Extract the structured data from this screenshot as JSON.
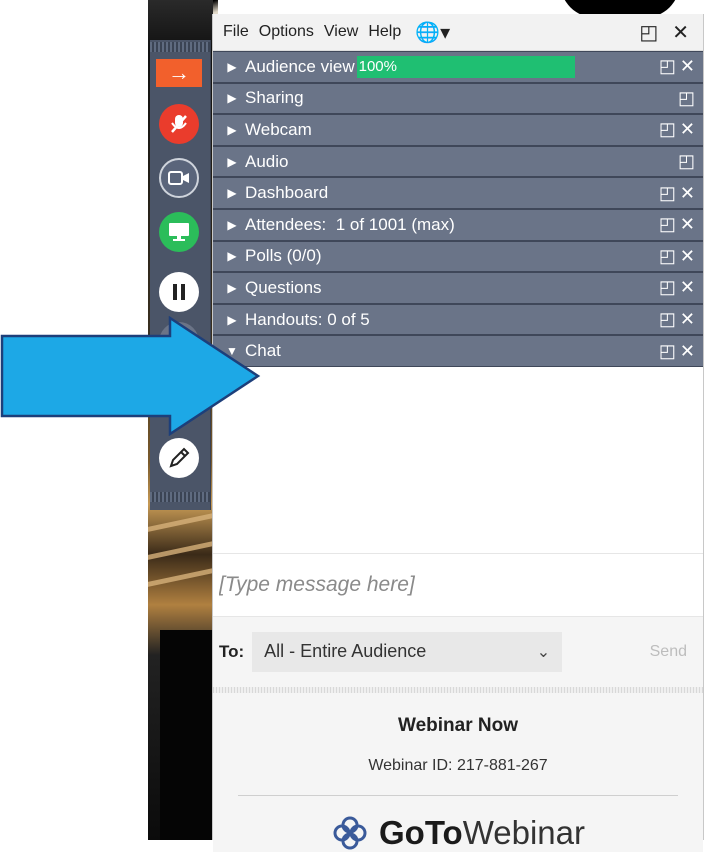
{
  "menu": {
    "items": [
      "File",
      "Options",
      "View",
      "Help"
    ],
    "globe_icon": "globe-icon",
    "window_controls": [
      "popout-icon",
      "close-icon"
    ]
  },
  "sections": [
    {
      "label": "Audience view",
      "progress": "100%",
      "progress_value": 1.0,
      "expanded": false
    },
    {
      "label": "Sharing",
      "expanded": false
    },
    {
      "label": "Webcam",
      "expanded": false
    },
    {
      "label": "Audio",
      "expanded": false
    },
    {
      "label": "Dashboard",
      "expanded": false
    },
    {
      "label": "Attendees:  1 of 1001 (max)",
      "expanded": false
    },
    {
      "label": "Polls (0/0)",
      "expanded": false
    },
    {
      "label": "Questions",
      "expanded": false
    },
    {
      "label": "Handouts: 0 of 5",
      "expanded": false
    },
    {
      "label": "Chat",
      "expanded": true
    }
  ],
  "chat": {
    "placeholder": "[Type message here]",
    "to_label": "To:",
    "to_value": "All - Entire Audience",
    "send_label": "Send"
  },
  "footer": {
    "name": "Webinar Now",
    "webinar_id": "Webinar ID: 217-881-267",
    "logo_goto": "GoTo",
    "logo_webinar": "Webinar"
  },
  "colors": {
    "section_bg": "#6a7488",
    "progress": "#1fbf72",
    "rail": "#4b5568",
    "arrow": "#1da8e6",
    "mic_red": "#ea3c2c",
    "screen_green": "#2bbd5a",
    "orange": "#f2602c"
  }
}
